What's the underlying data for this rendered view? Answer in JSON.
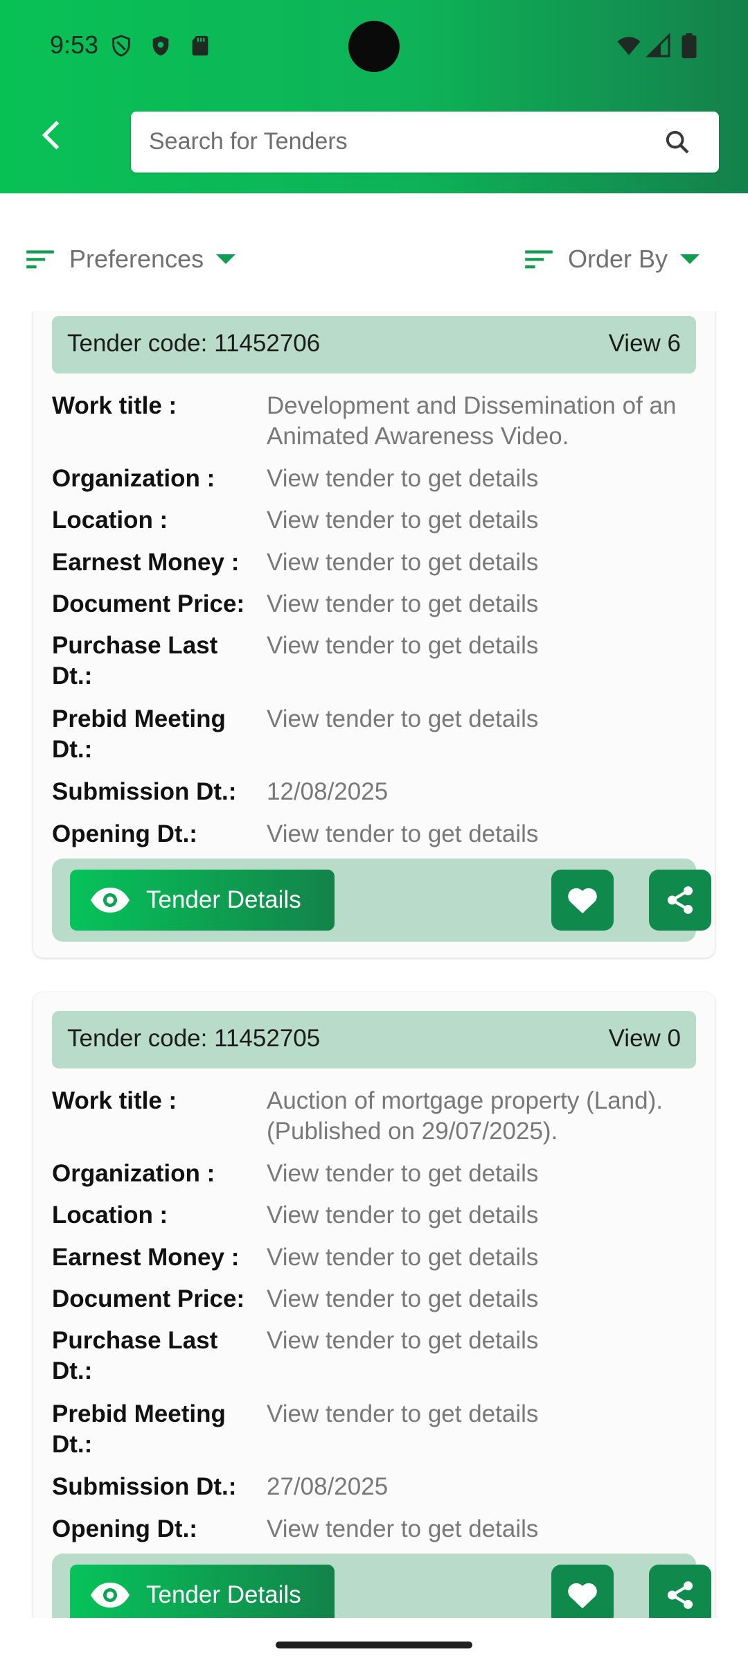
{
  "status_bar": {
    "time": "9:53",
    "left_icons": [
      "shield-outline-icon",
      "shield-filled-icon",
      "sd-card-icon"
    ],
    "right_icons": [
      "wifi-icon",
      "cell-signal-icon",
      "battery-icon"
    ]
  },
  "header": {
    "search_placeholder": "Search for Tenders",
    "back_icon": "arrow-back-icon",
    "search_icon": "search-icon",
    "gradient_colors": [
      "#08c155",
      "#14804b"
    ]
  },
  "filters": {
    "preferences_label": "Preferences",
    "order_by_label": "Order By",
    "icon": "sort-icon",
    "accent_color": "#129c52"
  },
  "tenders": [
    {
      "code_label": "Tender code: 11452706",
      "views_label": "View 6",
      "fields": [
        {
          "label": "Work title :",
          "value": "Development and Dissemination of an Animated Awareness Video."
        },
        {
          "label": "Organization :",
          "value": "View tender to get details"
        },
        {
          "label": "Location :",
          "value": "View tender to get details"
        },
        {
          "label": "Earnest Money :",
          "value": "View tender to get details"
        },
        {
          "label": "Document Price:",
          "value": "View tender to get details"
        },
        {
          "label": "Purchase Last Dt.:",
          "value": "View tender to get details"
        },
        {
          "label": "Prebid Meeting Dt.:",
          "value": "View tender to get details"
        },
        {
          "label": "Submission Dt.:",
          "value": "12/08/2025"
        },
        {
          "label": "Opening Dt.:",
          "value": "View tender to get details"
        }
      ],
      "details_button": "Tender Details"
    },
    {
      "code_label": "Tender code: 11452705",
      "views_label": "View 0",
      "fields": [
        {
          "label": "Work title :",
          "value": "Auction of mortgage property (Land). (Published on 29/07/2025)."
        },
        {
          "label": "Organization :",
          "value": "View tender to get details"
        },
        {
          "label": "Location :",
          "value": "View tender to get details"
        },
        {
          "label": "Earnest Money :",
          "value": "View tender to get details"
        },
        {
          "label": "Document Price:",
          "value": "View tender to get details"
        },
        {
          "label": "Purchase Last Dt.:",
          "value": "View tender to get details"
        },
        {
          "label": "Prebid Meeting Dt.:",
          "value": "View tender to get details"
        },
        {
          "label": "Submission Dt.:",
          "value": "27/08/2025"
        },
        {
          "label": "Opening Dt.:",
          "value": "View tender to get details"
        }
      ],
      "details_button": "Tender Details"
    }
  ]
}
